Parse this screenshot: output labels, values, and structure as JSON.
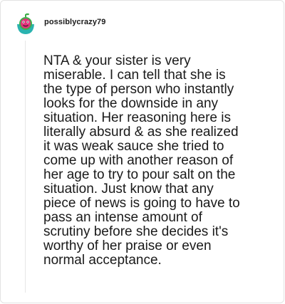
{
  "post": {
    "username": "possiblycrazy79",
    "avatar_icon": "cartoon-watermelon-avatar-icon",
    "comment_lines": [
      "NTA & your sister is very",
      "miserable. I can tell that she is",
      "the type of person who instantly",
      "looks for the downside in any",
      "situation. Her reasoning here is",
      "literally absurd & as she realized",
      "it was weak sauce she tried to",
      "come up with another reason of",
      "her age to try to pour salt on the",
      "situation. Just know that any",
      "piece of news is going to have to",
      "pass an intense amount of",
      "scrutiny before she decides it's",
      "worthy of her praise or even",
      "normal acceptance."
    ]
  },
  "colors": {
    "border": "#e3e3e3",
    "text": "#1a1a1a",
    "avatar_teal": "#2ab3b0",
    "avatar_pink": "#e0337a",
    "avatar_green": "#3fae4a"
  }
}
